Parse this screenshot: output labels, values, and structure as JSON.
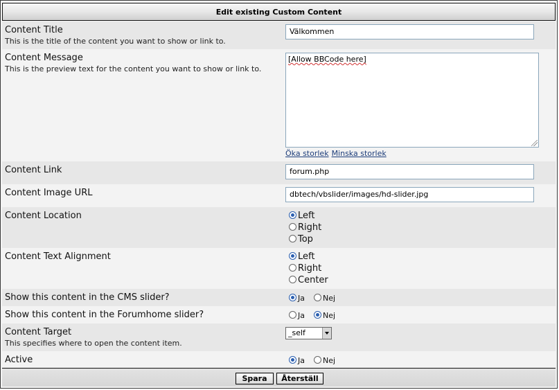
{
  "header": {
    "title": "Edit existing Custom Content"
  },
  "content_title": {
    "label": "Content Title",
    "description": "This is the title of the content you want to show or link to.",
    "value": "Välkommen"
  },
  "content_message": {
    "label": "Content Message",
    "description": "This is the preview text for the content you want to show or link to.",
    "value": "[Allow BBCode here]",
    "increase_size_label": "Öka storlek",
    "decrease_size_label": "Minska storlek"
  },
  "content_link": {
    "label": "Content Link",
    "value": "forum.php"
  },
  "content_image_url": {
    "label": "Content Image URL",
    "value": "dbtech/vbslider/images/hd-slider.jpg"
  },
  "content_location": {
    "label": "Content Location",
    "options": [
      "Left",
      "Right",
      "Top"
    ],
    "selected": "Left"
  },
  "content_text_alignment": {
    "label": "Content Text Alignment",
    "options": [
      "Left",
      "Right",
      "Center"
    ],
    "selected": "Left"
  },
  "show_cms": {
    "label": "Show this content in the CMS slider?",
    "yes_label": "Ja",
    "no_label": "Nej",
    "selected": "Ja"
  },
  "show_forumhome": {
    "label": "Show this content in the Forumhome slider?",
    "yes_label": "Ja",
    "no_label": "Nej",
    "selected": "Nej"
  },
  "content_target": {
    "label": "Content Target",
    "description": "This specifies where to open the content item.",
    "value": "_self"
  },
  "active": {
    "label": "Active",
    "yes_label": "Ja",
    "no_label": "Nej",
    "selected": "Ja"
  },
  "footer": {
    "save_label": "Spara",
    "reset_label": "Återställ"
  },
  "colors": {
    "radio_selected": "#2b5fb0",
    "link": "#1d3d7a",
    "input_border": "#8aa6bb"
  }
}
